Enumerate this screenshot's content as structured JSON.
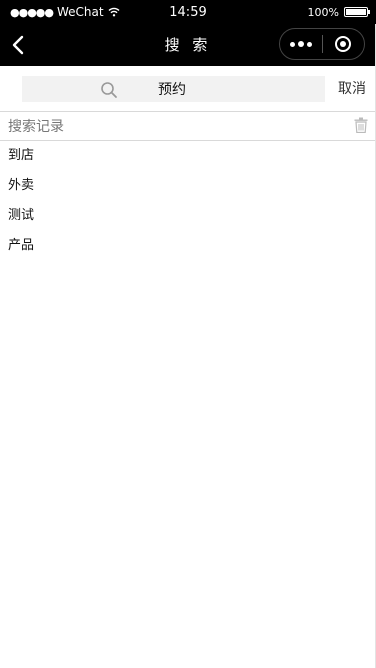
{
  "status_bar": {
    "carrier": "WeChat",
    "time": "14:59",
    "battery": "100%",
    "battery_level": 1.0
  },
  "nav": {
    "title": "搜 索"
  },
  "search": {
    "value": "预约",
    "cancel_label": "取消"
  },
  "history": {
    "title": "搜索记录",
    "items": [
      {
        "label": "到店"
      },
      {
        "label": "外卖"
      },
      {
        "label": "测试"
      },
      {
        "label": "产品"
      }
    ]
  },
  "icons": {
    "search": "search-icon",
    "trash": "trash-icon",
    "back": "back-chevron-icon"
  }
}
